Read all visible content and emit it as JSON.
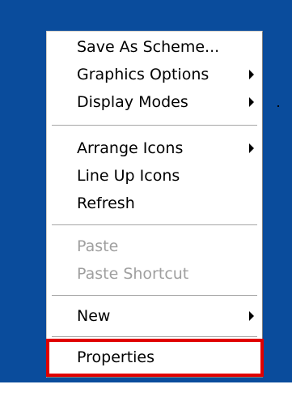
{
  "context_menu": {
    "items": [
      {
        "label": "Save As Scheme...",
        "submenu": false,
        "enabled": true
      },
      {
        "label": "Graphics Options",
        "submenu": true,
        "enabled": true
      },
      {
        "label": "Display Modes",
        "submenu": true,
        "enabled": true
      },
      {
        "label": "Arrange Icons",
        "submenu": true,
        "enabled": true
      },
      {
        "label": "Line Up Icons",
        "submenu": false,
        "enabled": true
      },
      {
        "label": "Refresh",
        "submenu": false,
        "enabled": true
      },
      {
        "label": "Paste",
        "submenu": false,
        "enabled": false
      },
      {
        "label": "Paste Shortcut",
        "submenu": false,
        "enabled": false
      },
      {
        "label": "New",
        "submenu": true,
        "enabled": true
      },
      {
        "label": "Properties",
        "submenu": false,
        "enabled": true
      }
    ]
  },
  "colors": {
    "desktop_background": "#0a4c9c",
    "menu_background": "#ffffff",
    "disabled_text": "#9f9f9f",
    "highlight_border": "#e00000"
  },
  "icons": {
    "submenu_arrow": "submenu-arrow-icon"
  }
}
